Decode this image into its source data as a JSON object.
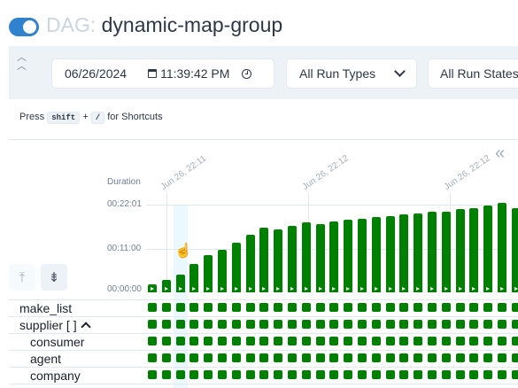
{
  "header": {
    "prefix": "DAG:",
    "dag_id": "dynamic-map-group"
  },
  "filters": {
    "date": "06/26/2024",
    "time": "11:39:42 PM",
    "run_types": "All Run Types",
    "run_states": "All Run States"
  },
  "shortcuts": {
    "press": "Press",
    "key1": "shift",
    "plus": "+",
    "key2": "/",
    "suffix": "for Shortcuts"
  },
  "chart": {
    "duration_label": "Duration",
    "y_ticks": [
      "00:22:01",
      "00:11:00",
      "00:00:00"
    ],
    "date_labels": [
      "Jun 26, 22:11",
      "Jun 26, 22:12",
      "Jun 26, 22:12"
    ]
  },
  "chart_data": {
    "type": "bar",
    "ylabel": "Duration",
    "ylim_seconds": [
      0,
      1321
    ],
    "values_seconds": [
      120,
      180,
      260,
      420,
      560,
      640,
      740,
      860,
      960,
      940,
      990,
      1050,
      1020,
      1060,
      1080,
      1100,
      1120,
      1140,
      1160,
      1170,
      1200,
      1200,
      1240,
      1250,
      1300,
      1330,
      1260
    ],
    "bar_color": "#008000"
  },
  "tasks": [
    {
      "name": "make_list",
      "indent": 0,
      "group": false
    },
    {
      "name": "supplier [ ]",
      "indent": 0,
      "group": true
    },
    {
      "name": "consumer",
      "indent": 1,
      "group": false
    },
    {
      "name": "agent",
      "indent": 1,
      "group": false
    },
    {
      "name": "company",
      "indent": 1,
      "group": false
    }
  ],
  "status_color": "#008000",
  "icons": {
    "toggle": "toggle-switch",
    "collapse": "double-chevron-up-icon",
    "expand_panel": "double-chevron-left-icon",
    "expand_all": "expand-vertical-icon",
    "collapse_all": "collapse-vertical-icon",
    "calendar": "calendar-icon",
    "clock": "clock-icon"
  }
}
